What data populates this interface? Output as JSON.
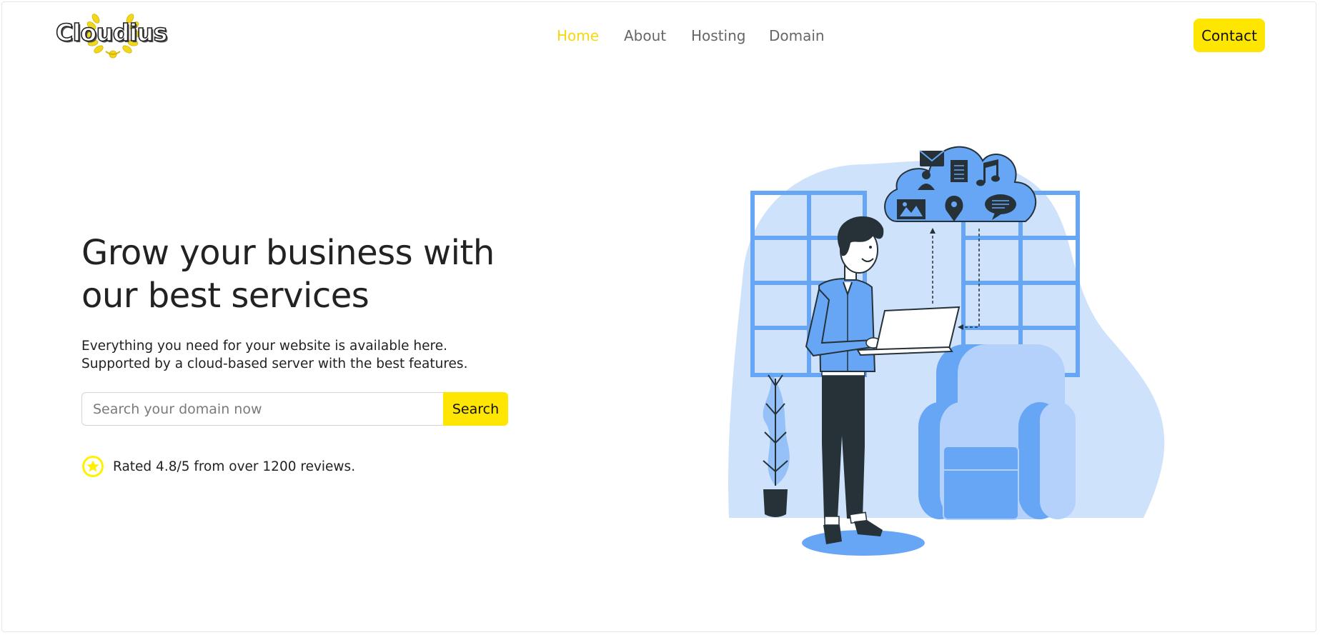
{
  "brand": {
    "name": "Cloudius"
  },
  "nav": {
    "items": [
      {
        "label": "Home",
        "active": true
      },
      {
        "label": "About",
        "active": false
      },
      {
        "label": "Hosting",
        "active": false
      },
      {
        "label": "Domain",
        "active": false
      }
    ],
    "contact_label": "Contact"
  },
  "hero": {
    "title": "Grow your business with our best services",
    "subtitle_line1": "Everything you need for your website is available here.",
    "subtitle_line2": "Supported by a cloud-based server with the best features.",
    "search": {
      "placeholder": "Search your domain now",
      "button_label": "Search"
    },
    "rating_text": "Rated 4.8/5 from over 1200 reviews."
  },
  "colors": {
    "accent": "#ffe600",
    "active_nav": "#f5d90a",
    "illustration_blue": "#66a6f5",
    "illustration_light": "#cfe2fb",
    "dark": "#263238"
  },
  "icons": [
    "laurel-icon",
    "star-icon",
    "mail-icon",
    "user-icon",
    "document-icon",
    "music-note-icon",
    "image-icon",
    "location-pin-icon",
    "chat-icon"
  ]
}
